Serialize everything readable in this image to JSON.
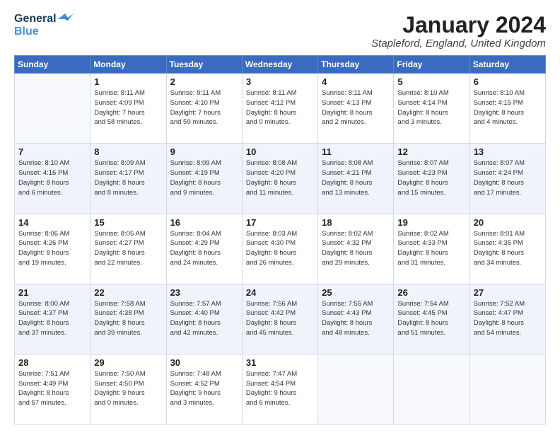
{
  "logo": {
    "line1": "General",
    "line2": "Blue"
  },
  "title": "January 2024",
  "subtitle": "Stapleford, England, United Kingdom",
  "days_of_week": [
    "Sunday",
    "Monday",
    "Tuesday",
    "Wednesday",
    "Thursday",
    "Friday",
    "Saturday"
  ],
  "weeks": [
    [
      {
        "day": "",
        "info": ""
      },
      {
        "day": "1",
        "info": "Sunrise: 8:11 AM\nSunset: 4:09 PM\nDaylight: 7 hours\nand 58 minutes."
      },
      {
        "day": "2",
        "info": "Sunrise: 8:11 AM\nSunset: 4:10 PM\nDaylight: 7 hours\nand 59 minutes."
      },
      {
        "day": "3",
        "info": "Sunrise: 8:11 AM\nSunset: 4:12 PM\nDaylight: 8 hours\nand 0 minutes."
      },
      {
        "day": "4",
        "info": "Sunrise: 8:11 AM\nSunset: 4:13 PM\nDaylight: 8 hours\nand 2 minutes."
      },
      {
        "day": "5",
        "info": "Sunrise: 8:10 AM\nSunset: 4:14 PM\nDaylight: 8 hours\nand 3 minutes."
      },
      {
        "day": "6",
        "info": "Sunrise: 8:10 AM\nSunset: 4:15 PM\nDaylight: 8 hours\nand 4 minutes."
      }
    ],
    [
      {
        "day": "7",
        "info": "Sunrise: 8:10 AM\nSunset: 4:16 PM\nDaylight: 8 hours\nand 6 minutes."
      },
      {
        "day": "8",
        "info": "Sunrise: 8:09 AM\nSunset: 4:17 PM\nDaylight: 8 hours\nand 8 minutes."
      },
      {
        "day": "9",
        "info": "Sunrise: 8:09 AM\nSunset: 4:19 PM\nDaylight: 8 hours\nand 9 minutes."
      },
      {
        "day": "10",
        "info": "Sunrise: 8:08 AM\nSunset: 4:20 PM\nDaylight: 8 hours\nand 11 minutes."
      },
      {
        "day": "11",
        "info": "Sunrise: 8:08 AM\nSunset: 4:21 PM\nDaylight: 8 hours\nand 13 minutes."
      },
      {
        "day": "12",
        "info": "Sunrise: 8:07 AM\nSunset: 4:23 PM\nDaylight: 8 hours\nand 15 minutes."
      },
      {
        "day": "13",
        "info": "Sunrise: 8:07 AM\nSunset: 4:24 PM\nDaylight: 8 hours\nand 17 minutes."
      }
    ],
    [
      {
        "day": "14",
        "info": "Sunrise: 8:06 AM\nSunset: 4:26 PM\nDaylight: 8 hours\nand 19 minutes."
      },
      {
        "day": "15",
        "info": "Sunrise: 8:05 AM\nSunset: 4:27 PM\nDaylight: 8 hours\nand 22 minutes."
      },
      {
        "day": "16",
        "info": "Sunrise: 8:04 AM\nSunset: 4:29 PM\nDaylight: 8 hours\nand 24 minutes."
      },
      {
        "day": "17",
        "info": "Sunrise: 8:03 AM\nSunset: 4:30 PM\nDaylight: 8 hours\nand 26 minutes."
      },
      {
        "day": "18",
        "info": "Sunrise: 8:02 AM\nSunset: 4:32 PM\nDaylight: 8 hours\nand 29 minutes."
      },
      {
        "day": "19",
        "info": "Sunrise: 8:02 AM\nSunset: 4:33 PM\nDaylight: 8 hours\nand 31 minutes."
      },
      {
        "day": "20",
        "info": "Sunrise: 8:01 AM\nSunset: 4:35 PM\nDaylight: 8 hours\nand 34 minutes."
      }
    ],
    [
      {
        "day": "21",
        "info": "Sunrise: 8:00 AM\nSunset: 4:37 PM\nDaylight: 8 hours\nand 37 minutes."
      },
      {
        "day": "22",
        "info": "Sunrise: 7:58 AM\nSunset: 4:38 PM\nDaylight: 8 hours\nand 39 minutes."
      },
      {
        "day": "23",
        "info": "Sunrise: 7:57 AM\nSunset: 4:40 PM\nDaylight: 8 hours\nand 42 minutes."
      },
      {
        "day": "24",
        "info": "Sunrise: 7:56 AM\nSunset: 4:42 PM\nDaylight: 8 hours\nand 45 minutes."
      },
      {
        "day": "25",
        "info": "Sunrise: 7:55 AM\nSunset: 4:43 PM\nDaylight: 8 hours\nand 48 minutes."
      },
      {
        "day": "26",
        "info": "Sunrise: 7:54 AM\nSunset: 4:45 PM\nDaylight: 8 hours\nand 51 minutes."
      },
      {
        "day": "27",
        "info": "Sunrise: 7:52 AM\nSunset: 4:47 PM\nDaylight: 8 hours\nand 54 minutes."
      }
    ],
    [
      {
        "day": "28",
        "info": "Sunrise: 7:51 AM\nSunset: 4:49 PM\nDaylight: 8 hours\nand 57 minutes."
      },
      {
        "day": "29",
        "info": "Sunrise: 7:50 AM\nSunset: 4:50 PM\nDaylight: 9 hours\nand 0 minutes."
      },
      {
        "day": "30",
        "info": "Sunrise: 7:48 AM\nSunset: 4:52 PM\nDaylight: 9 hours\nand 3 minutes."
      },
      {
        "day": "31",
        "info": "Sunrise: 7:47 AM\nSunset: 4:54 PM\nDaylight: 9 hours\nand 6 minutes."
      },
      {
        "day": "",
        "info": ""
      },
      {
        "day": "",
        "info": ""
      },
      {
        "day": "",
        "info": ""
      }
    ]
  ]
}
